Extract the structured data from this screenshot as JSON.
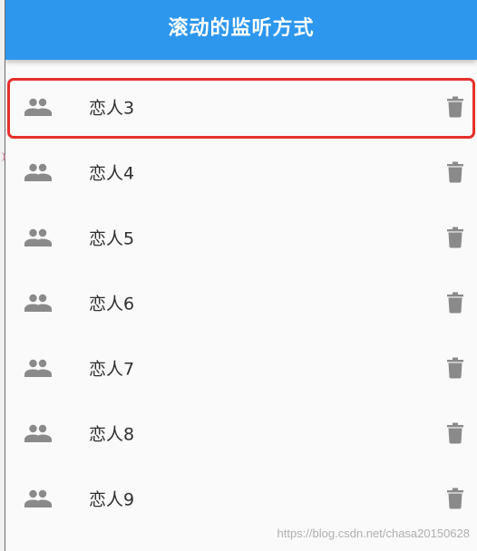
{
  "app_bar": {
    "title": "滚动的监听方式",
    "color": "#2d97ee"
  },
  "list": {
    "items": [
      {
        "label": "恋人3",
        "leading_icon": "people-icon",
        "trailing_icon": "delete-icon"
      },
      {
        "label": "恋人4",
        "leading_icon": "people-icon",
        "trailing_icon": "delete-icon"
      },
      {
        "label": "恋人5",
        "leading_icon": "people-icon",
        "trailing_icon": "delete-icon"
      },
      {
        "label": "恋人6",
        "leading_icon": "people-icon",
        "trailing_icon": "delete-icon"
      },
      {
        "label": "恋人7",
        "leading_icon": "people-icon",
        "trailing_icon": "delete-icon"
      },
      {
        "label": "恋人8",
        "leading_icon": "people-icon",
        "trailing_icon": "delete-icon"
      },
      {
        "label": "恋人9",
        "leading_icon": "people-icon",
        "trailing_icon": "delete-icon"
      }
    ]
  },
  "icon_color": "#8a8a8a",
  "highlight_color": "#e5302a",
  "watermark": "https://blog.csdn.net/chasa20150628"
}
